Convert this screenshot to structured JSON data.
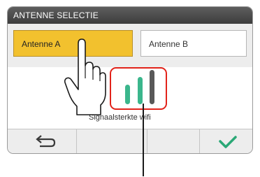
{
  "title": "ANTENNE SELECTIE",
  "tabs": [
    {
      "label": "Antenne A",
      "selected": true
    },
    {
      "label": "Antenne B",
      "selected": false
    }
  ],
  "signal": {
    "label": "Signaalsterkte wifi",
    "bars_active": 2,
    "bars_total": 3
  },
  "icons": {
    "back": "back-arrow-icon",
    "confirm": "checkmark-icon",
    "hand": "pointing-hand-icon"
  },
  "colors": {
    "selected_tab": "#f2c12e",
    "signal_active": "#3bb68c",
    "signal_inactive": "#595959",
    "highlight": "#e2231a",
    "confirm": "#2aa876"
  }
}
